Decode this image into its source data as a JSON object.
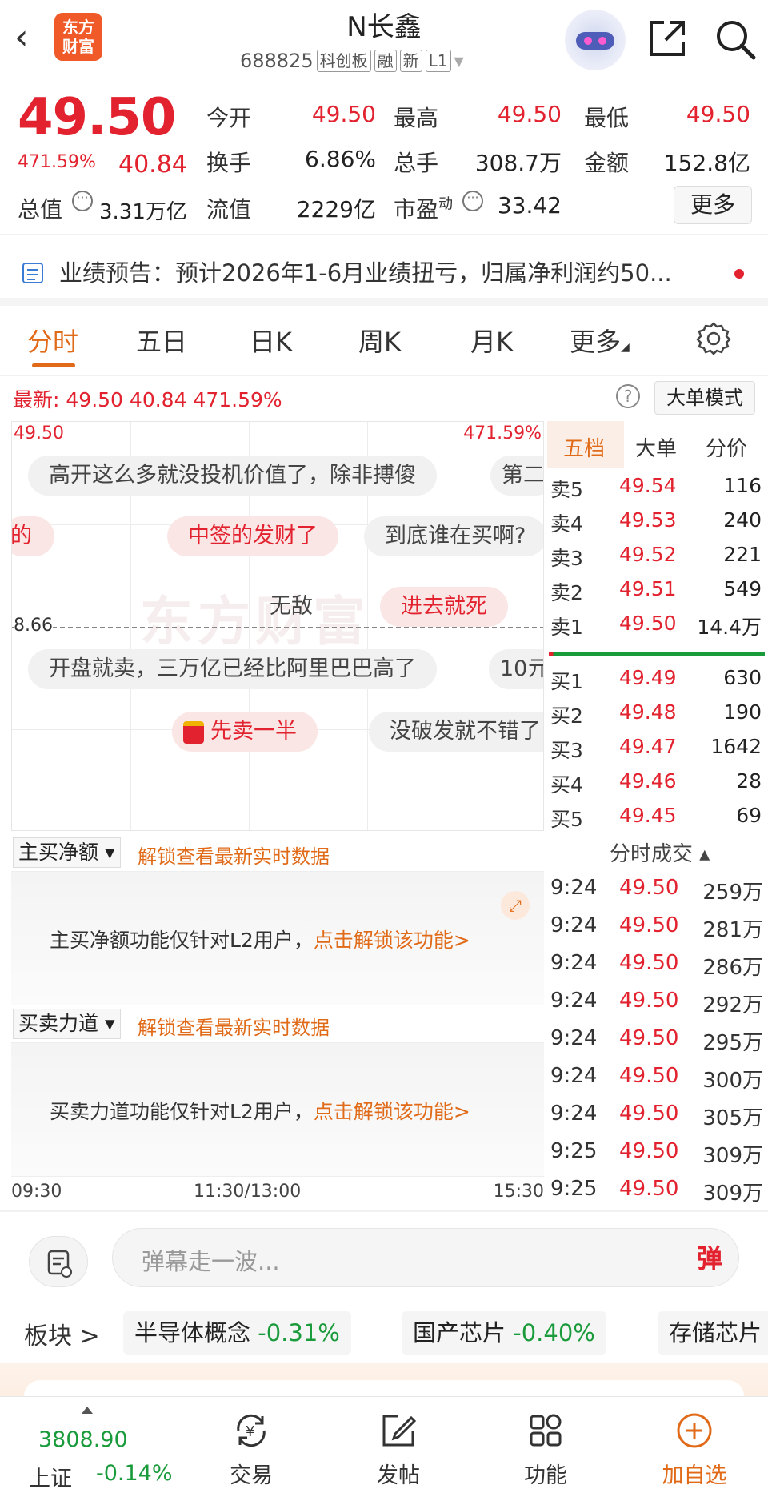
{
  "header": {
    "back": "‹",
    "logo_line1": "东方",
    "logo_line2": "财富",
    "name": "N长鑫",
    "code": "688825",
    "tags": [
      "科创板",
      "融",
      "新",
      "L1"
    ],
    "icons": [
      "share-icon",
      "search-icon"
    ]
  },
  "quote": {
    "price": "49.50",
    "change_pct": "471.59%",
    "change": "40.84",
    "fields": [
      {
        "label": "今开",
        "value": "49.50",
        "color": "#e2232f"
      },
      {
        "label": "最高",
        "value": "49.50",
        "color": "#e2232f"
      },
      {
        "label": "最低",
        "value": "49.50",
        "color": "#e2232f"
      },
      {
        "label": "换手",
        "value": "6.86%",
        "color": "#222222"
      },
      {
        "label": "总手",
        "value": "308.7万",
        "color": "#222222"
      },
      {
        "label": "金额",
        "value": "152.8亿",
        "color": "#222222"
      }
    ],
    "total_value_label": "总值",
    "total_value": "3.31万亿",
    "float_value_label": "流值",
    "float_value": "2229亿",
    "pe_label": "市盈",
    "pe_sup": "动",
    "pe_value": "33.42",
    "more_label": "更多"
  },
  "notice": {
    "text": "业绩预告：预计2026年1-6月业绩扭亏，归属净利润约50..."
  },
  "tabs": [
    "分时",
    "五日",
    "日K",
    "周K",
    "月K",
    "更多"
  ],
  "latest": {
    "label": "最新:",
    "price": "49.50",
    "change": "40.84",
    "pct": "471.59%",
    "help": "?",
    "bigorder_label": "大单模式"
  },
  "chart": {
    "y_top": "49.50",
    "y_top_pct": "471.59%",
    "y_prev": "8.66",
    "watermark": "东方财富",
    "time_labels": [
      "09:30",
      "11:30/13:00",
      "15:30"
    ]
  },
  "danmu": [
    {
      "text": "高开这么多就没投机价值了，除非搏傻",
      "pink": false
    },
    {
      "text": "第二",
      "pink": false
    },
    {
      "text": "的",
      "pink": true
    },
    {
      "text": "中签的发财了",
      "pink": true
    },
    {
      "text": "到底谁在买啊?",
      "pink": false
    },
    {
      "text": "无敌",
      "pink": false
    },
    {
      "text": "进去就死",
      "pink": true
    },
    {
      "text": "开盘就卖，三万亿已经比阿里巴巴高了",
      "pink": false
    },
    {
      "text": "10亓",
      "pink": false
    },
    {
      "text": "先卖一半",
      "pink": true
    },
    {
      "text": "没破发就不错了",
      "pink": false
    }
  ],
  "book": {
    "tabs": [
      "五档",
      "大单",
      "分价"
    ],
    "sell": [
      {
        "label": "卖5",
        "price": "49.54",
        "qty": "116"
      },
      {
        "label": "卖4",
        "price": "49.53",
        "qty": "240"
      },
      {
        "label": "卖3",
        "price": "49.52",
        "qty": "221"
      },
      {
        "label": "卖2",
        "price": "49.51",
        "qty": "549"
      },
      {
        "label": "卖1",
        "price": "49.50",
        "qty": "14.4万"
      }
    ],
    "buy": [
      {
        "label": "买1",
        "price": "49.49",
        "qty": "630"
      },
      {
        "label": "买2",
        "price": "49.48",
        "qty": "190"
      },
      {
        "label": "买3",
        "price": "49.47",
        "qty": "1642"
      },
      {
        "label": "买4",
        "price": "49.46",
        "qty": "28"
      },
      {
        "label": "买5",
        "price": "49.45",
        "qty": "69"
      }
    ]
  },
  "ticks": {
    "title": "分时成交 ▴",
    "rows": [
      {
        "time": "9:24",
        "price": "49.50",
        "vol": "259万"
      },
      {
        "time": "9:24",
        "price": "49.50",
        "vol": "281万"
      },
      {
        "time": "9:24",
        "price": "49.50",
        "vol": "286万"
      },
      {
        "time": "9:24",
        "price": "49.50",
        "vol": "292万"
      },
      {
        "time": "9:24",
        "price": "49.50",
        "vol": "295万"
      },
      {
        "time": "9:24",
        "price": "49.50",
        "vol": "300万"
      },
      {
        "time": "9:24",
        "price": "49.50",
        "vol": "305万"
      },
      {
        "time": "9:25",
        "price": "49.50",
        "vol": "309万"
      },
      {
        "time": "9:25",
        "price": "49.50",
        "vol": "309万"
      }
    ]
  },
  "l2": {
    "net_buy_select": "主买净额 ▾",
    "force_select": "买卖力道 ▾",
    "unlock_link": "解锁查看最新实时数据",
    "net_buy_msg": "主买净额功能仅针对L2用户，",
    "force_msg": "买卖力道功能仅针对L2用户，",
    "unlock_action": "点击解锁该功能>"
  },
  "comment": {
    "placeholder": "弹幕走一波...",
    "danmu_btn": "弹"
  },
  "sectors": {
    "label": "板块 >",
    "items": [
      {
        "name": "半导体概念",
        "pct": "-0.31%"
      },
      {
        "name": "国产芯片",
        "pct": "-0.40%"
      },
      {
        "name": "存储芯片",
        "pct": ""
      }
    ]
  },
  "nav": {
    "index_value": "3808.90",
    "index_name": "上证",
    "index_pct": "-0.14%",
    "items": [
      {
        "label": "交易",
        "icon": "trade-icon"
      },
      {
        "label": "发帖",
        "icon": "post-icon"
      },
      {
        "label": "功能",
        "icon": "apps-icon"
      },
      {
        "label": "加自选",
        "icon": "add-watch-icon"
      }
    ]
  }
}
